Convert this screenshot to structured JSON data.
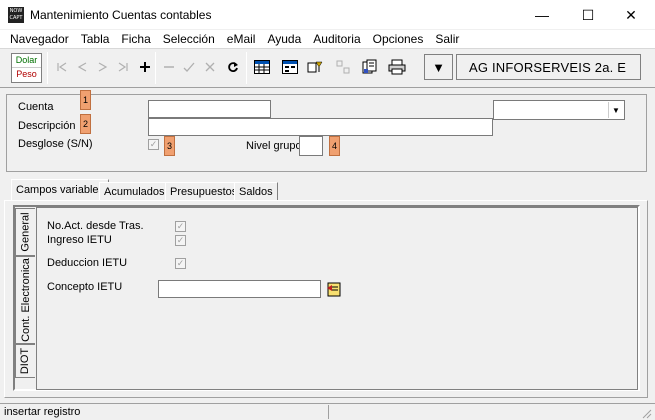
{
  "window": {
    "title": "Mantenimiento Cuentas contables",
    "app_icon_text": "NOW CAPT",
    "minimize_glyph": "—",
    "maximize_glyph": "☐",
    "close_glyph": "✕"
  },
  "menu": [
    "Navegador",
    "Tabla",
    "Ficha",
    "Selección",
    "eMail",
    "Ayuda",
    "Auditoria",
    "Opciones",
    "Salir"
  ],
  "toolbar": {
    "currency_top": "Dolar",
    "currency_bottom": "Peso",
    "company_name": "AG INFORSERVEIS 2a. E",
    "dropdown_glyph": "▼"
  },
  "form": {
    "cuenta_label": "Cuenta",
    "descripcion_label": "Descripción",
    "desglose_label": "Desglose (S/N)",
    "nivel_label": "Nivel grupo",
    "badges": [
      "1",
      "2",
      "3",
      "4"
    ],
    "cuenta_value": "",
    "descripcion_value": "",
    "nivel_value": "",
    "select_value": "",
    "desglose_checked": true
  },
  "tabs": [
    "Campos variables",
    "Acumulados",
    "Presupuestos",
    "Saldos"
  ],
  "active_tab": "Campos variables",
  "vertical_tabs": [
    "General",
    "Cont. Electronica",
    "DIOT"
  ],
  "active_vertical_tab": "General",
  "general": {
    "noact_label": "No.Act. desde Tras.",
    "ingreso_label": "Ingreso IETU",
    "deduccion_label": "Deduccion IETU",
    "concepto_label": "Concepto IETU",
    "concepto_value": "",
    "check_glyph": "✓"
  },
  "status": {
    "text": "insertar registro"
  },
  "colors": {
    "badge": "#f0a070",
    "dolar": "#007000",
    "peso": "#b00000"
  }
}
